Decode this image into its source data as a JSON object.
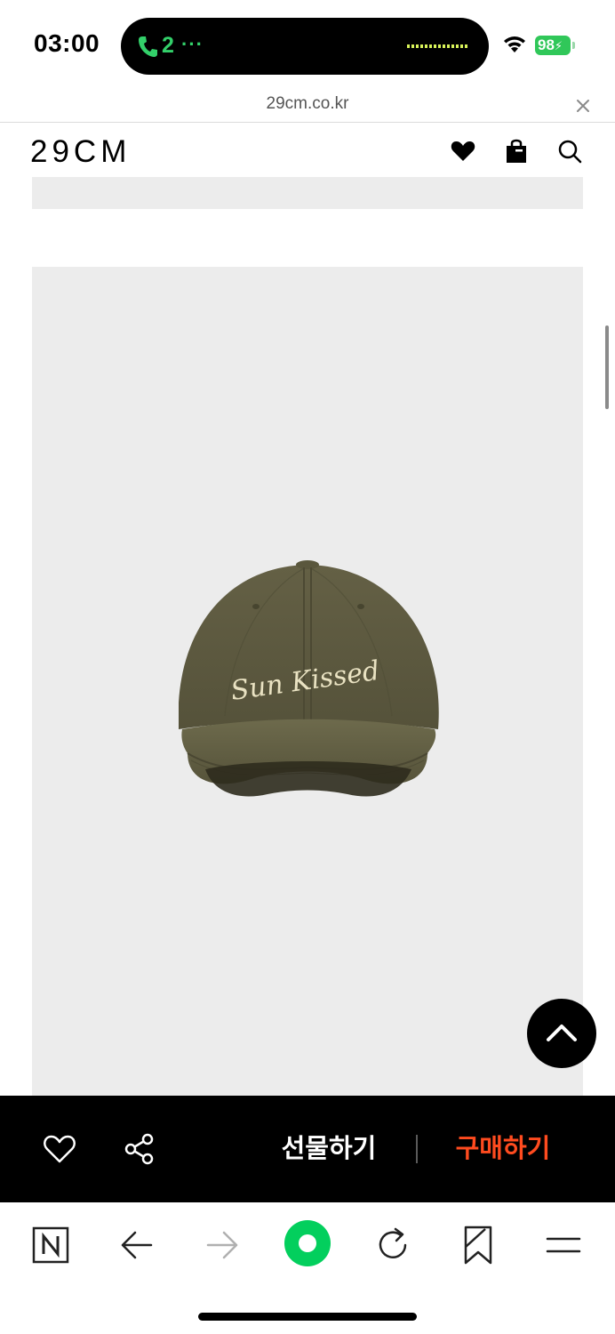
{
  "status_bar": {
    "time": "03:00",
    "call_label": "2",
    "call_more": "···",
    "battery": "98"
  },
  "url_bar": {
    "url": "29cm.co.kr"
  },
  "header": {
    "logo": "29CM"
  },
  "purchase_bar": {
    "gift_label": "선물하기",
    "buy_label": "구매하기"
  },
  "product": {
    "cap_embroidery": "Sun Kissed"
  },
  "colors": {
    "accent": "#ff4b1f",
    "call_green": "#33d06a",
    "battery_green": "#30c759",
    "naver_green": "#03cf5d",
    "cap_olive": "#5e5a3c"
  }
}
